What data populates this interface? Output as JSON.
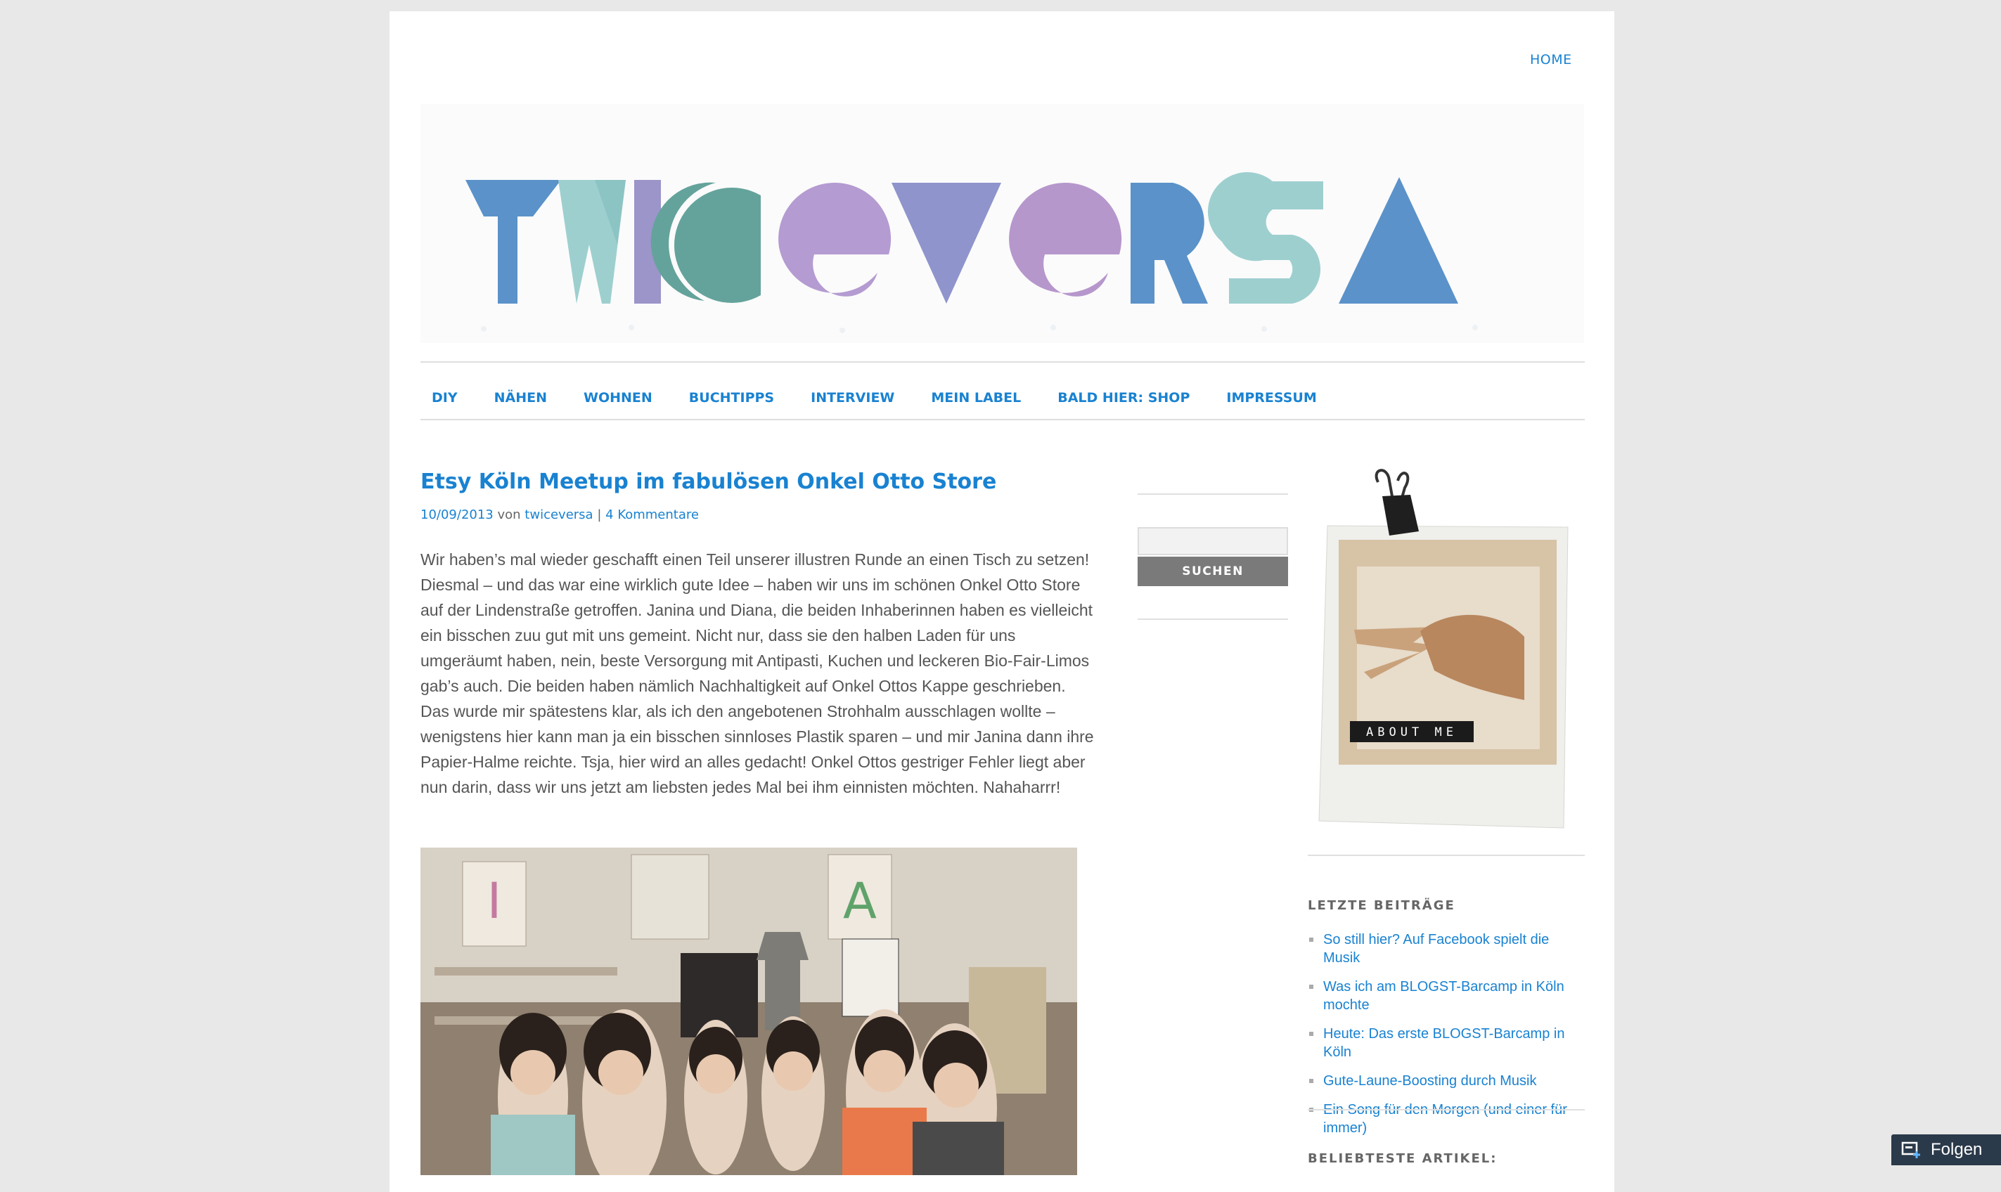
{
  "header": {
    "home_label": "HOME"
  },
  "logo": {
    "text": "TWICEVERSA",
    "colors": [
      "#5b92c9",
      "#9ecfcf",
      "#9b95c9",
      "#64a39b",
      "#b49bd1",
      "#8f94cc",
      "#b697cc",
      "#5b92c9",
      "#9ecfcf",
      "#5b92c9"
    ]
  },
  "nav": {
    "items": [
      "DIY",
      "NÄHEN",
      "WOHNEN",
      "BUCHTIPPS",
      "INTERVIEW",
      "MEIN LABEL",
      "BALD HIER: SHOP",
      "IMPRESSUM"
    ]
  },
  "post": {
    "title": "Etsy Köln Meetup im fabulösen Onkel Otto Store",
    "date": "10/09/2013",
    "by_label": "von",
    "author": "twiceversa",
    "separator": "|",
    "comments": "4 Kommentare",
    "body": "Wir haben’s mal wieder geschafft einen Teil unserer illustren Runde an einen Tisch zu setzen! Diesmal – und das war eine wirklich gute Idee – haben wir uns im schönen Onkel Otto Store auf der Lindenstraße getroffen. Janina und Diana, die beiden Inhaberinnen haben es vielleicht ein bisschen zuu gut mit uns gemeint. Nicht nur, dass sie den halben Laden für uns umgeräumt haben, nein, beste Versorgung mit Antipasti, Kuchen und leckeren Bio-Fair-Limos gab’s auch. Die beiden haben nämlich Nachhaltigkeit auf Onkel Ottos Kappe geschrieben. Das wurde mir spätestens klar, als ich den angebotenen Strohhalm ausschlagen wollte – wenigstens hier kann man ja ein bisschen sinnloses Plastik sparen – und mir Janina dann ihre Papier-Halme reichte. Tsja, hier wird an alles gedacht! Onkel Ottos gestriger Fehler liegt aber nun darin, dass wir uns jetzt am liebsten jedes Mal bei ihm einnisten möchten. Nahaharrr!"
  },
  "search": {
    "button_label": "SUCHEN",
    "value": ""
  },
  "about": {
    "label": "ABOUT ME"
  },
  "sidebar": {
    "recent_title": "LETZTE BEITRÄGE",
    "recent_posts": [
      "So still hier? Auf Facebook spielt die Musik",
      "Was ich am BLOGST-Barcamp in Köln mochte",
      "Heute: Das erste BLOGST-Barcamp in Köln",
      "Gute-Laune-Boosting durch Musik",
      "Ein Song für den Morgen (und einer für immer)"
    ],
    "popular_title": "BELIEBTESTE ARTIKEL:"
  },
  "follow": {
    "label": "Folgen"
  },
  "photo": {
    "wall_letters": [
      "I",
      "A"
    ]
  }
}
